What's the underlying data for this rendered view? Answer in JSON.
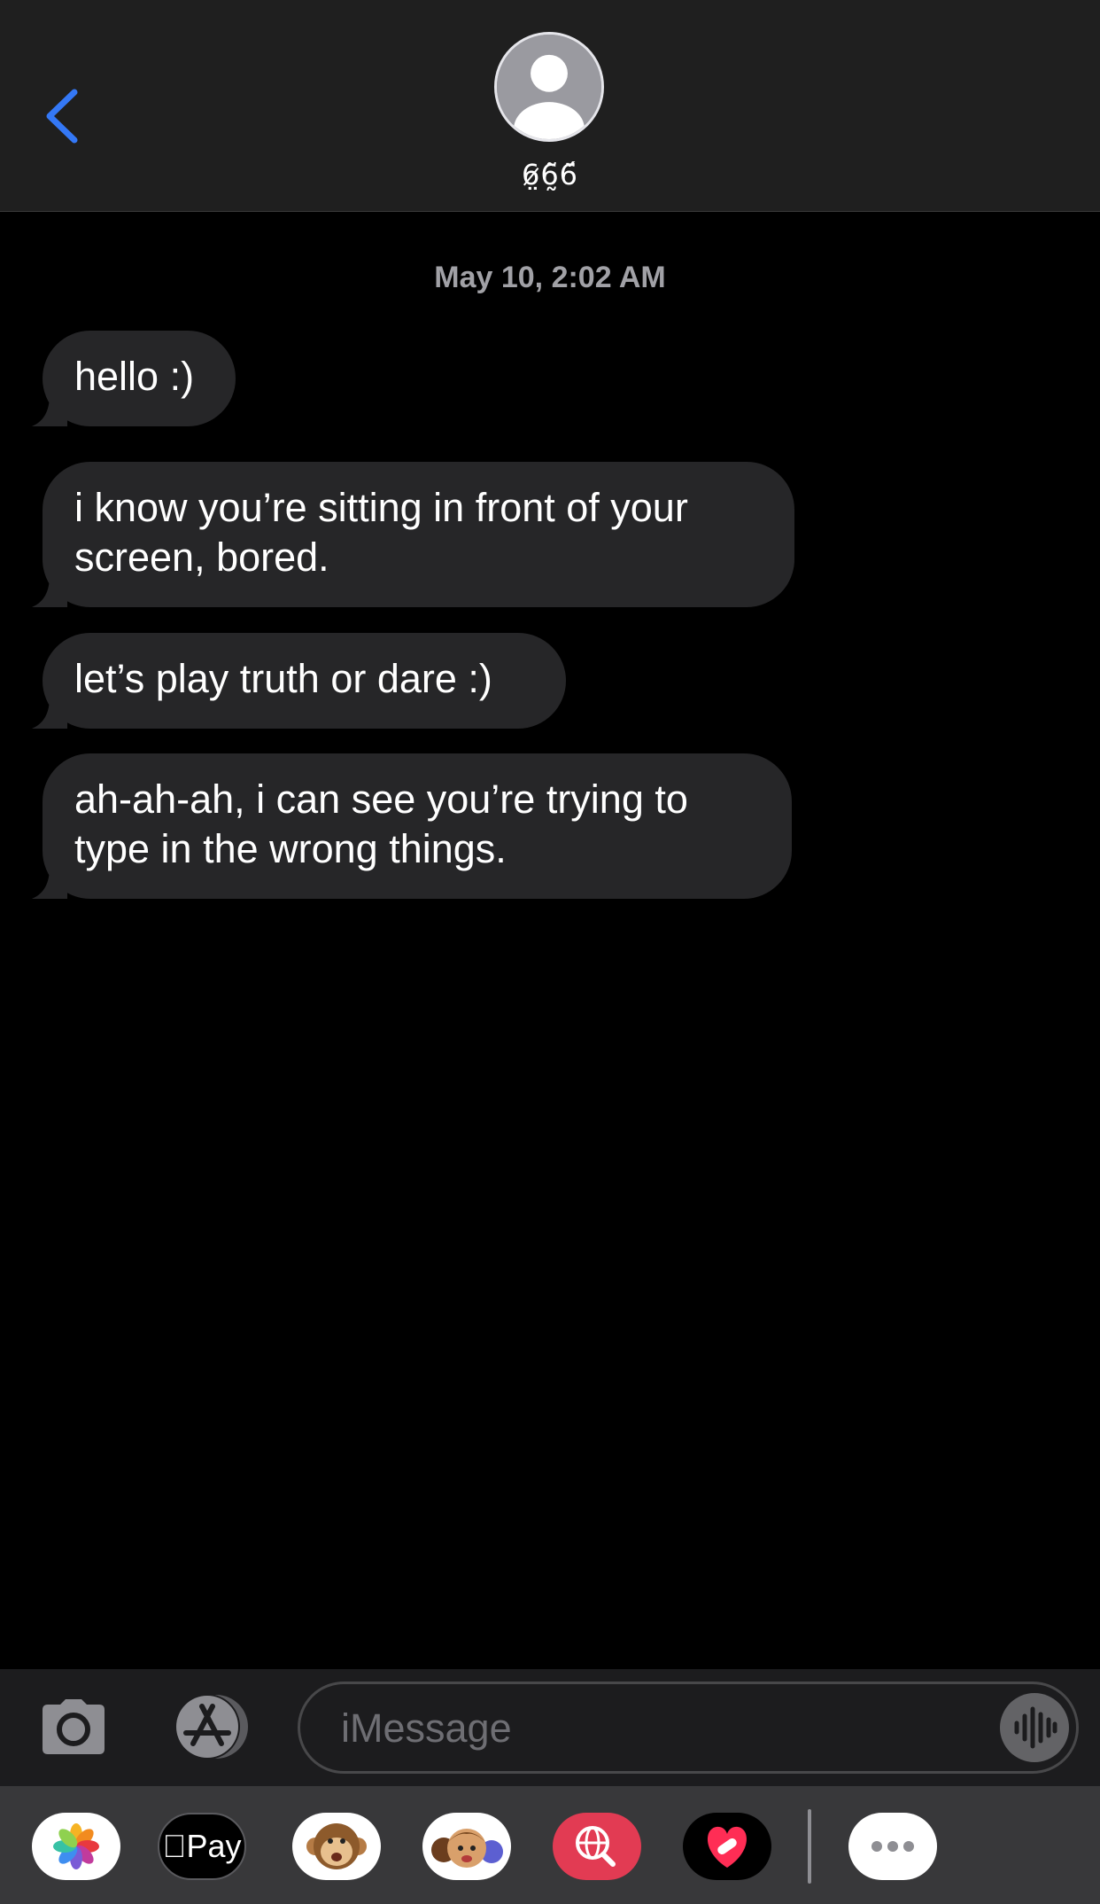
{
  "header": {
    "contact_name": "6̷̤6̰̃6̈́",
    "back_icon": "chevron-left-icon",
    "avatar_icon": "person-silhouette-icon",
    "accent_color": "#3478f6"
  },
  "conversation": {
    "timestamp": "May 10, 2:02 AM",
    "messages": [
      {
        "direction": "incoming",
        "text": "hello :)"
      },
      {
        "direction": "incoming",
        "text": "i know you’re sitting in front of your screen, bored."
      },
      {
        "direction": "incoming",
        "text": "let’s play truth or dare :)"
      },
      {
        "direction": "incoming",
        "text": "ah-ah-ah, i can see you’re trying to type in the wrong things."
      }
    ]
  },
  "input_bar": {
    "camera_icon": "camera-icon",
    "apps_icon": "app-store-icon",
    "message_placeholder": "iMessage",
    "message_value": "",
    "voice_icon": "waveform-icon"
  },
  "app_drawer": {
    "apps": [
      {
        "name": "Photos",
        "icon": "photos-icon"
      },
      {
        "name": "Apple Pay",
        "label": "Pay",
        "icon": "apple-pay-icon"
      },
      {
        "name": "Animoji",
        "icon": "monkey-animoji-icon"
      },
      {
        "name": "Memoji",
        "icon": "memoji-icon"
      },
      {
        "name": "Images",
        "icon": "globe-search-icon"
      },
      {
        "name": "Digital Touch",
        "icon": "heart-touch-icon"
      },
      {
        "name": "More",
        "icon": "more-dots-icon"
      }
    ]
  }
}
